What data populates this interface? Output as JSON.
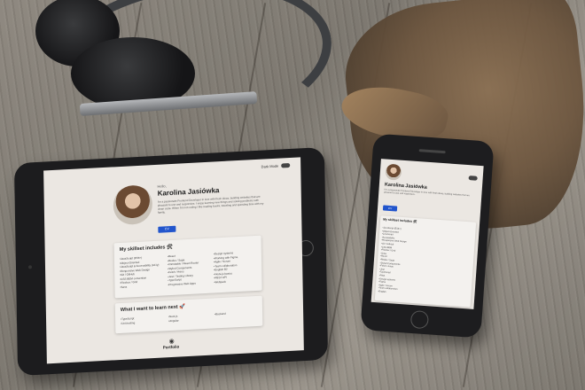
{
  "tablet_site": {
    "greeting": "Hello,",
    "name": "Karolina Jasiówka",
    "bio": "I'm a passionate Frontend Developer in love with fresh ideas, building websites that are pleasant to use and responsive. I enjoy learning new things and solving problems with clean code. When I'm not coding I like reading books, traveling and spending time with my family.",
    "cv_button": "CV",
    "dark_mode_label": "Dark Mode",
    "skills_title": "My skillset includes 🛠",
    "skills_col1": [
      "JavaScript (ES6+)",
      "Object-Oriented",
      "JavaScript & Accessibility (A11y)",
      "Responsive Web Design",
      "Git / GitHub",
      "CSS BEM convention",
      "Flexbox / Grid",
      "Sass"
    ],
    "skills_col2": [
      "React",
      "Redux / Saga",
      "Immutable / React Router",
      "Styled Components",
      "Fetch / Axios",
      "Jest / Testing Library",
      "TypeScript",
      "Progressive Web Apps"
    ],
    "skills_col3": [
      "Design systems",
      "Working with Figma",
      "Agile / Scrum",
      "Team collaboration",
      "English B2",
      "Node.js basics",
      "REST API",
      "Webpack"
    ],
    "learn_title": "What I want to learn next 🚀",
    "learn_col1": [
      "TypeScript",
      "Unit testing"
    ],
    "learn_col2": [
      "Next.js",
      "Angular"
    ],
    "learn_col3": [
      "Backend"
    ],
    "footer_label": "Portfolio"
  },
  "phone_site": {
    "greeting": "Hello,",
    "name": "Karolina Jasiówka",
    "bio": "I'm a passionate Frontend Developer in love with fresh ideas, building websites that are pleasant to use and responsive.",
    "cv_button": "CV",
    "skills_title": "My skillset includes 🛠",
    "skills": [
      "JavaScript (ES6+)",
      "Object-Oriented",
      "JavaScript",
      "Accessibility",
      "Responsive Web Design",
      "Git / GitHub",
      "CSS BEM",
      "Flexbox / Grid",
      "Sass",
      "React",
      "Redux / Saga",
      "Styled Components",
      "Fetch / Axios",
      "Jest",
      "TypeScript",
      "PWA",
      "Design systems",
      "Figma",
      "Agile / Scrum",
      "Team collaboration",
      "English"
    ]
  },
  "colors": {
    "accent": "#2255cc",
    "page_bg": "#ebe7e2",
    "card_bg": "#f3f1ee"
  }
}
